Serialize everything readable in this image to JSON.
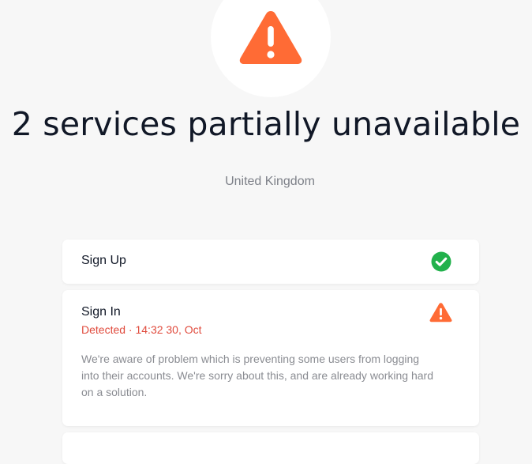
{
  "hero": {
    "icon": "warning-triangle-icon",
    "icon_color": "#ff6b35"
  },
  "title": "2 services partially unavailable",
  "region": "United Kingdom",
  "services": [
    {
      "name": "Sign Up",
      "status": "operational",
      "status_icon": "check-circle-icon",
      "status_color": "#22b14c"
    },
    {
      "name": "Sign In",
      "status": "partially unavailable",
      "status_icon": "warning-triangle-icon",
      "status_color": "#ff6b35",
      "detected": "Detected · 14:32 30, Oct",
      "description": "We're aware of problem which is preventing some users from logging into their accounts. We're sorry about this, and are already working hard on a solution."
    }
  ],
  "colors": {
    "background": "#f7f7f7",
    "card": "#ffffff",
    "detected_text": "#e04a3c"
  }
}
